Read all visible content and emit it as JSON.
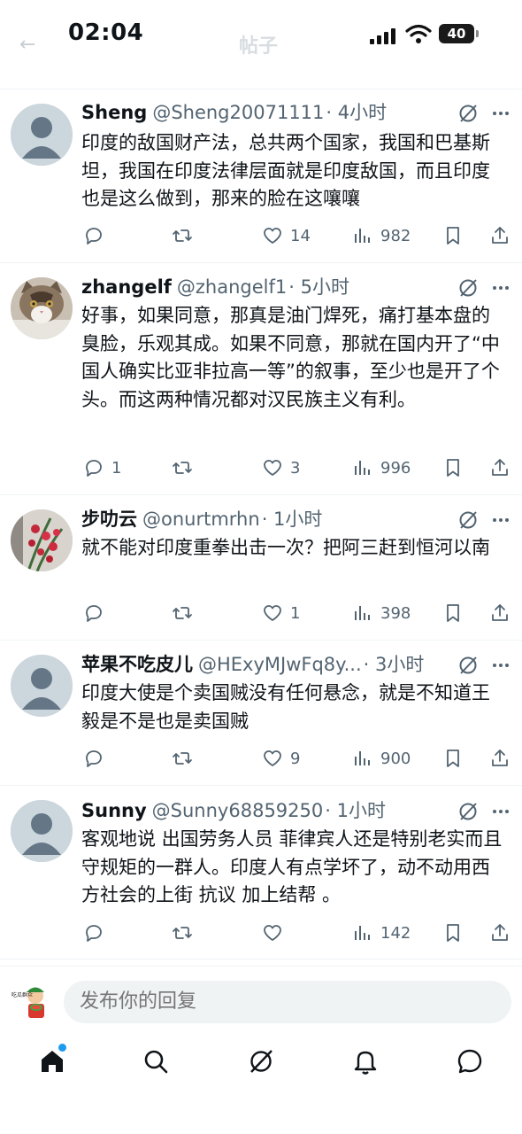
{
  "status_bar": {
    "time": "02:04",
    "battery": "40"
  },
  "header": {
    "title": "帖子"
  },
  "posts": [
    {
      "name": "Sheng",
      "handle": "@Sheng20071111",
      "time": "· 4小时",
      "text": "印度的敌国财产法，总共两个国家，我国和巴基斯坦，我国在印度法律层面就是印度敌国，而且印度也是这么做到，那来的脸在这嚷嚷",
      "replies": "",
      "reposts": "",
      "likes": "14",
      "views": "982",
      "avatar": "default-avatar"
    },
    {
      "name": "zhangelf",
      "handle": "@zhangelf1",
      "time": "· 5小时",
      "text": "好事，如果同意，那真是油门焊死，痛打基本盘的臭脸，乐观其成。如果不同意，那就在国内开了“中国人确实比亚非拉高一等”的叙事，至少也是开了个头。而这两种情况都对汉民族主义有利。",
      "replies": "1",
      "reposts": "",
      "likes": "3",
      "views": "996",
      "avatar": "cat-avatar"
    },
    {
      "name": "步叻云",
      "handle": "@onurtmrhn",
      "time": "· 1小时",
      "text": "就不能对印度重拳出击一次？把阿三赶到恒河以南",
      "replies": "",
      "reposts": "",
      "likes": "1",
      "views": "398",
      "avatar": "flower-avatar"
    },
    {
      "name": "苹果不吃皮儿",
      "handle": "@HExyMJwFq8y...",
      "time": "· 3小时",
      "text": "印度大使是个卖国贼没有任何悬念，就是不知道王毅是不是也是卖国贼",
      "replies": "",
      "reposts": "",
      "likes": "9",
      "views": "900",
      "avatar": "default-avatar"
    },
    {
      "name": "Sunny",
      "handle": "@Sunny68859250",
      "time": "· 1小时",
      "text": "客观地说 出国劳务人员 菲律宾人还是特别老实而且守规矩的一群人。印度人有点学坏了，动不动用西方社会的上街 抗议 加上结帮 。",
      "replies": "",
      "reposts": "",
      "likes": "",
      "views": "142",
      "avatar": "default-avatar"
    }
  ],
  "reply_bar": {
    "placeholder": "发布你的回复",
    "avatar_text": "吃瓜群众"
  },
  "tabs": [
    "home",
    "search",
    "grok",
    "notifications",
    "messages"
  ],
  "colors": {
    "accent": "#1d9bf0",
    "secondary_text": "#536471",
    "divider": "#eff3f4"
  }
}
